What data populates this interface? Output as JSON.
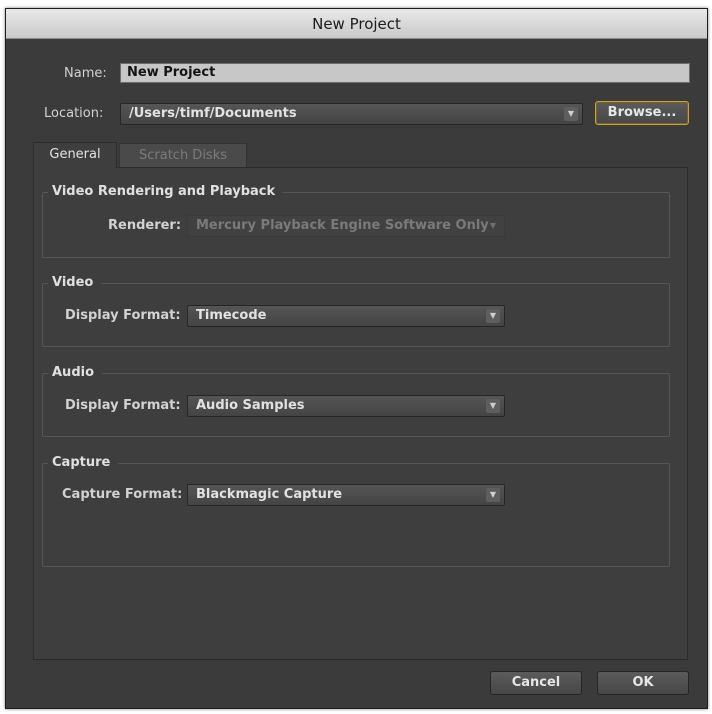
{
  "window": {
    "title": "New Project"
  },
  "name_row": {
    "label": "Name:",
    "value": "New Project"
  },
  "location_row": {
    "label": "Location:",
    "value": "/Users/timf/Documents",
    "browse_label": "Browse..."
  },
  "tabs": [
    {
      "label": "General",
      "active": true
    },
    {
      "label": "Scratch Disks",
      "active": false
    }
  ],
  "video_rendering": {
    "title": "Video Rendering and Playback",
    "renderer_label": "Renderer:",
    "renderer_value": "Mercury Playback Engine Software Only"
  },
  "video": {
    "title": "Video",
    "display_format_label": "Display Format:",
    "display_format_value": "Timecode"
  },
  "audio": {
    "title": "Audio",
    "display_format_label": "Display Format:",
    "display_format_value": "Audio Samples"
  },
  "capture": {
    "title": "Capture",
    "capture_format_label": "Capture Format:",
    "capture_format_value": "Blackmagic Capture"
  },
  "footer": {
    "cancel_label": "Cancel",
    "ok_label": "OK"
  },
  "icons": {
    "dropdown_arrow": "chevron-down-icon"
  },
  "colors": {
    "dialog_bg": "#3b3b3b",
    "focus_ring": "#c9a23c"
  }
}
